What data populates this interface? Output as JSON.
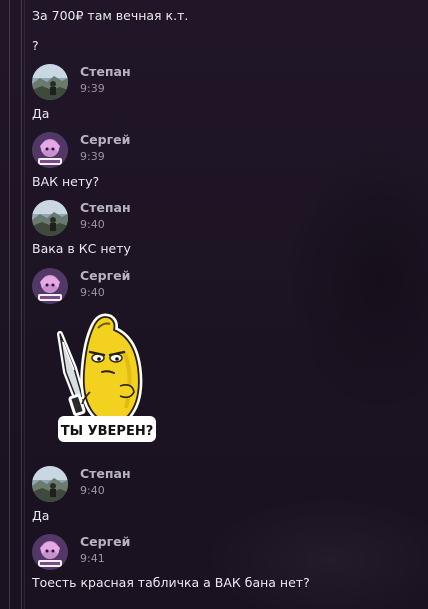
{
  "chat": {
    "messages": [
      {
        "text": "За 700₽ там вечная к.т."
      },
      {
        "text": "?"
      },
      {
        "author": "Степан",
        "time": "9:39",
        "text": "Да"
      },
      {
        "author": "Сергей",
        "time": "9:39",
        "text": "ВАК нету?"
      },
      {
        "author": "Степан",
        "time": "9:40",
        "text": "Вака в КС нету"
      },
      {
        "author": "Сергей",
        "time": "9:40",
        "sticker": {
          "caption": "ТЫ УВЕРЕН?"
        }
      },
      {
        "author": "Степан",
        "time": "9:40",
        "text": "Да"
      },
      {
        "author": "Сергей",
        "time": "9:41",
        "text": "Тоесть красная табличка а ВАК бана нет?"
      }
    ]
  },
  "colors": {
    "background": "#1d1424",
    "text": "#ece8f0",
    "author": "#b9b3c1",
    "time": "#9a93a4",
    "sticker_yellow": "#f2d21e"
  },
  "icons": {
    "avatar_stepan": "stepan-avatar",
    "avatar_sergey": "sergey-avatar",
    "sticker": "banana-with-knife-sticker"
  }
}
